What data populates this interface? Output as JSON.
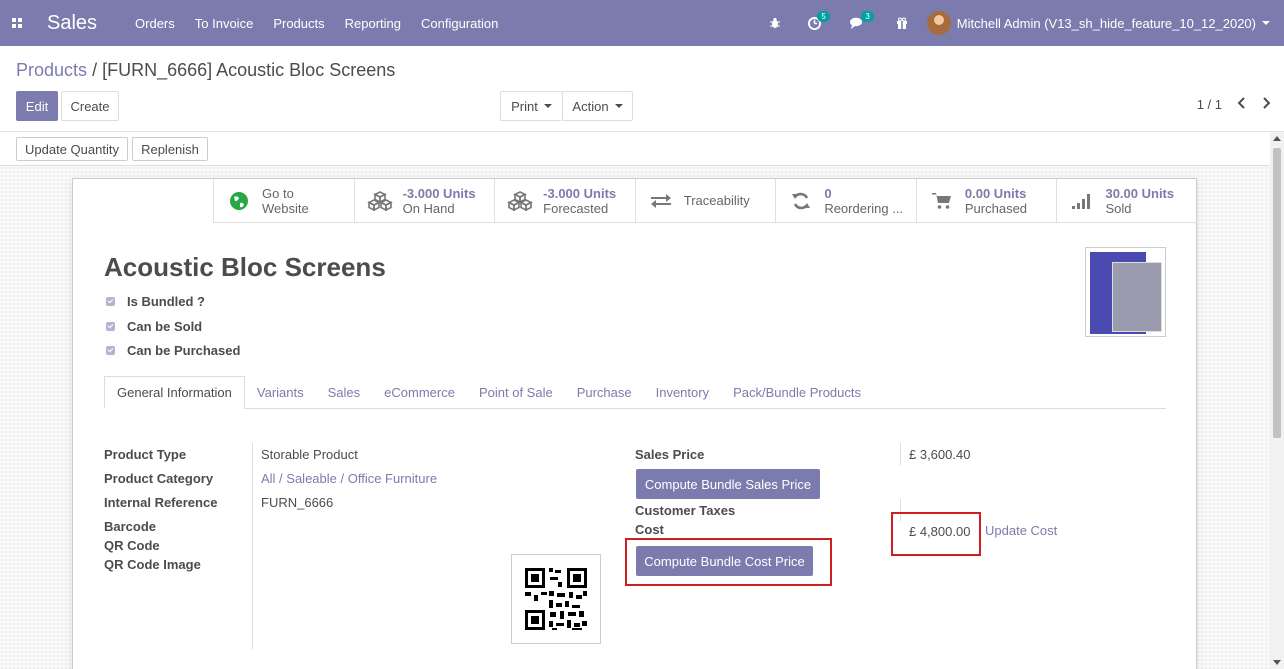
{
  "navbar": {
    "app_name": "Sales",
    "menu": [
      "Orders",
      "To Invoice",
      "Products",
      "Reporting",
      "Configuration"
    ],
    "activity_badge": "5",
    "messages_badge": "3",
    "user_name": "Mitchell Admin (V13_sh_hide_feature_10_12_2020)"
  },
  "breadcrumb": {
    "parent": "Products",
    "separator": "/",
    "current": "[FURN_6666] Acoustic Bloc Screens"
  },
  "buttons": {
    "edit": "Edit",
    "create": "Create",
    "print": "Print",
    "action": "Action",
    "update_quantity": "Update Quantity",
    "replenish": "Replenish"
  },
  "pager": {
    "value": "1 / 1"
  },
  "smart_buttons": [
    {
      "icon": "globe-icon",
      "value": "Go to",
      "label": "Website"
    },
    {
      "icon": "cubes-icon",
      "value": "-3.000 Units",
      "label": "On Hand"
    },
    {
      "icon": "cubes-icon",
      "value": "-3.000 Units",
      "label": "Forecasted"
    },
    {
      "icon": "arrows-icon",
      "value": "Traceability",
      "label": ""
    },
    {
      "icon": "refresh-icon",
      "value": "0",
      "label": "Reordering ..."
    },
    {
      "icon": "cart-icon",
      "value": "0.00 Units",
      "label": "Purchased"
    },
    {
      "icon": "bar-chart-icon",
      "value": "30.00 Units",
      "label": "Sold"
    }
  ],
  "product": {
    "name": "Acoustic Bloc Screens",
    "checkboxes": [
      "Is Bundled ?",
      "Can be Sold",
      "Can be Purchased"
    ]
  },
  "tabs": [
    "General Information",
    "Variants",
    "Sales",
    "eCommerce",
    "Point of Sale",
    "Purchase",
    "Inventory",
    "Pack/Bundle Products"
  ],
  "general": {
    "product_type_label": "Product Type",
    "product_type": "Storable Product",
    "category_label": "Product Category",
    "category": "All / Saleable / Office Furniture",
    "internal_ref_label": "Internal Reference",
    "internal_ref": "FURN_6666",
    "barcode_label": "Barcode",
    "qr_code_label": "QR Code",
    "qr_image_label": "QR Code Image",
    "sales_price_label": "Sales Price",
    "sales_price": "£ 3,600.40",
    "compute_sales_btn": "Compute Bundle Sales Price",
    "customer_taxes_label": "Customer Taxes",
    "cost_label": "Cost",
    "cost": "£ 4,800.00",
    "update_cost": "Update Cost",
    "compute_cost_btn": "Compute Bundle Cost Price"
  },
  "colors": {
    "brand": "#7c7bad",
    "highlight": "#cc1f1f"
  }
}
